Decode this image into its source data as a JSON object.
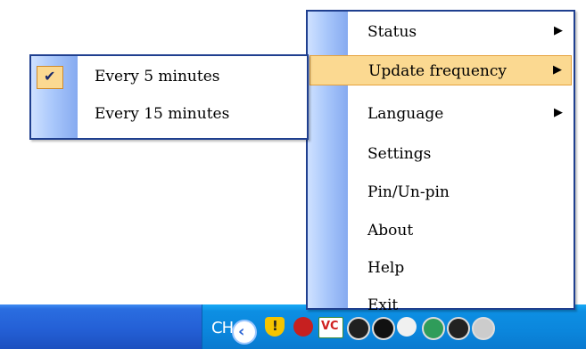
{
  "context_menu": {
    "items": [
      {
        "label": "Status",
        "has_submenu": true
      },
      {
        "label": "Update frequency",
        "has_submenu": true,
        "highlighted": true
      },
      {
        "label": "Language",
        "has_submenu": true
      },
      {
        "label": "Settings",
        "has_submenu": false
      },
      {
        "label": "Pin/Un-pin",
        "has_submenu": false
      },
      {
        "label": "About",
        "has_submenu": false
      },
      {
        "label": "Help",
        "has_submenu": false
      },
      {
        "label": "Exit",
        "has_submenu": false
      }
    ],
    "submenu_arrow": "▶"
  },
  "submenu": {
    "items": [
      {
        "label": "Every 5 minutes",
        "checked": true
      },
      {
        "label": "Every 15 minutes",
        "checked": false
      }
    ],
    "check_glyph": "✔"
  },
  "taskbar": {
    "language_indicator": "CH",
    "tray_icons": [
      "chevron-left-icon",
      "shield-warning-icon",
      "red-shield-icon",
      "vc-icon",
      "dark-circle-icon",
      "info-circle-icon",
      "white-circle-icon",
      "green-circle-icon",
      "black-circle-icon",
      "grey-circle-icon"
    ],
    "colors": {
      "taskbar_blue": "#2460d6",
      "tray_blue": "#0b86dc",
      "highlight": "#fbd991"
    }
  }
}
